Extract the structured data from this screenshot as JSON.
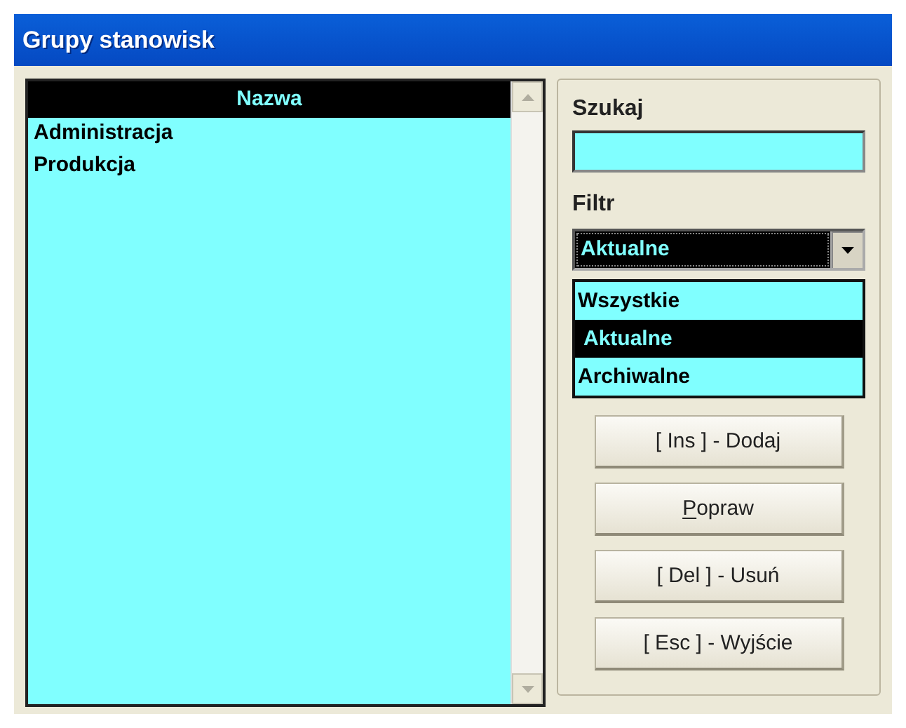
{
  "window": {
    "title": "Grupy stanowisk"
  },
  "list": {
    "column": "Nazwa",
    "rows": [
      {
        "name": "Administracja",
        "selected": false
      },
      {
        "name": "Produkcja",
        "selected": false
      }
    ]
  },
  "search": {
    "label": "Szukaj"
  },
  "filter": {
    "label": "Filtr",
    "value": "Aktualne",
    "expanded": true,
    "options": [
      {
        "label": "Wszystkie",
        "selected": false
      },
      {
        "label": "Aktualne",
        "selected": true
      },
      {
        "label": "Archiwalne",
        "selected": false
      }
    ]
  },
  "buttons": [
    {
      "label": "[ Ins ] - Dodaj",
      "underline_first": false
    },
    {
      "label": "Popraw",
      "underline_first": true
    },
    {
      "label": "[ Del ] - Usuń",
      "underline_first": false
    },
    {
      "label": "[ Esc ] - Wyjście",
      "underline_first": false
    }
  ]
}
